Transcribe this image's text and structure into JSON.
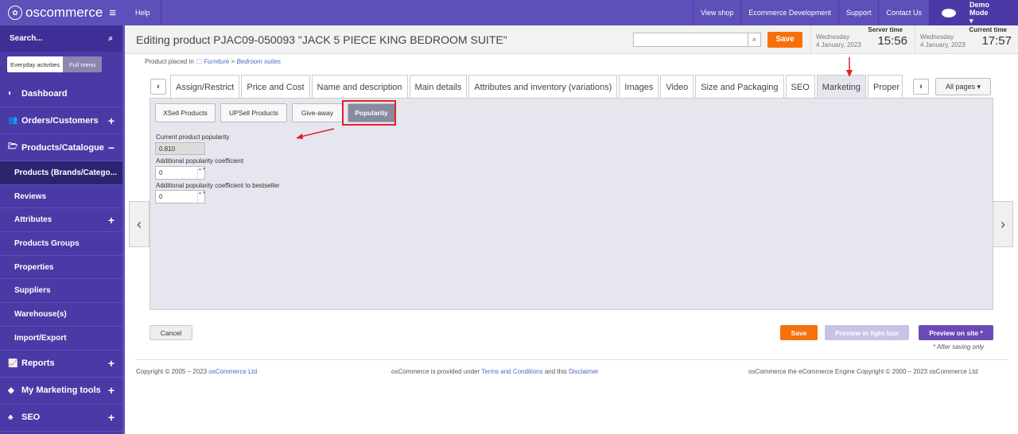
{
  "sidebar": {
    "logo": "oscommerce",
    "logo_mark": "✿",
    "menu_icon": "≡",
    "search_label": "Search...",
    "search_icon": "⌕",
    "mode_everyday": "Everyday activities",
    "mode_full": "Full menu",
    "items": [
      {
        "icon": "◐",
        "label": "Dashboard"
      },
      {
        "icon": "👥",
        "label": "Orders/Customers",
        "expand": "+"
      },
      {
        "icon": "🗁",
        "label": "Products/Catalogue",
        "expand": "−"
      }
    ],
    "subitems": [
      {
        "label": "Products (Brands/Catego...",
        "expand": ""
      },
      {
        "label": "Reviews",
        "expand": ""
      },
      {
        "label": "Attributes",
        "expand": "+"
      },
      {
        "label": "Products Groups",
        "expand": ""
      },
      {
        "label": "Properties",
        "expand": ""
      },
      {
        "label": "Suppliers",
        "expand": ""
      },
      {
        "label": "Warehouse(s)",
        "expand": ""
      },
      {
        "label": "Import/Export",
        "expand": ""
      }
    ],
    "bottom": [
      {
        "icon": "📈",
        "label": "Reports",
        "expand": "+"
      },
      {
        "icon": "◆",
        "label": "My Marketing tools",
        "expand": "+"
      },
      {
        "icon": "♣",
        "label": "SEO",
        "expand": "+"
      }
    ]
  },
  "topbar": {
    "help": "Help",
    "view_shop": "View shop",
    "ecommerce_dev": "Ecommerce Development",
    "support": "Support",
    "contact": "Contact Us",
    "user": "Demo Mode ▾"
  },
  "header": {
    "title": "Editing product PJAC09-050093 \"JACK 5 PIECE KING BEDROOM SUITE\"",
    "search_value": "",
    "search_icon": "🔍",
    "save": "Save",
    "server": {
      "label": "Server time",
      "day": "Wednesday",
      "date": "4 January, 2023",
      "time": "15:56"
    },
    "current": {
      "label": "Current time",
      "day": "Wednesday",
      "date": "4 January, 2023",
      "time": "17:57"
    }
  },
  "breadcrumb": {
    "prefix": "Product placed in",
    "icon": "🗀",
    "cat": "Furniture",
    "sep": " > ",
    "sub": "Bedroom suites"
  },
  "tabs": [
    "Assign/Restrict",
    "Price and Cost",
    "Name and description",
    "Main details",
    "Attributes and inventory (variations)",
    "Images",
    "Video",
    "Size and Packaging",
    "SEO",
    "Marketing",
    "Proper"
  ],
  "tab_prev": "‹",
  "tab_next": "›",
  "all_pages": "All pages ▾",
  "subtabs": [
    "XSell Products",
    "UPSell Products",
    "Give-away",
    "Popularity"
  ],
  "fields": {
    "current_label": "Current product popularity",
    "current_value": "0.810",
    "coef_label": "Additional popularity coefficient",
    "coef_value": "0",
    "best_label": "Additional popularity coefficient to bestseller",
    "best_value": "0",
    "spin": "▲▼"
  },
  "nav_prev": "‹",
  "nav_next": "›",
  "buttons": {
    "cancel": "Cancel",
    "save": "Save",
    "preview_lightbox": "Preview in light box",
    "preview_site": "Preview on site *",
    "after": "* After saving only"
  },
  "footer": {
    "copy": "Copyright © 2005 – 2023",
    "copy_link": "osCommerce Ltd",
    "mid": "osCommerce is provided under",
    "terms": "Terms and Conditions",
    "and": "and this",
    "disclaimer": "Disclaimer",
    "right": "osCommerce the eCommerce Engine Copyright © 2000 – 2023 osCommerce Ltd"
  },
  "colors": {
    "sidebar": "#4a3aa6",
    "accent_orange": "#f7700c",
    "purple_button": "#6a4bb5",
    "highlight": "#e0212a"
  }
}
